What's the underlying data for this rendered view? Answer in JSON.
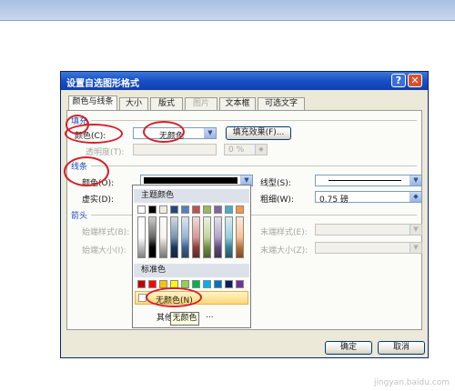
{
  "dialog": {
    "title": "设置自选图形格式",
    "help_glyph": "?",
    "close_glyph": "✕",
    "tabs": [
      {
        "label": "颜色与线条",
        "state": "active"
      },
      {
        "label": "大小",
        "state": "normal"
      },
      {
        "label": "版式",
        "state": "normal"
      },
      {
        "label": "图片",
        "state": "disabled"
      },
      {
        "label": "文本框",
        "state": "normal"
      },
      {
        "label": "可选文字",
        "state": "normal"
      }
    ],
    "fill": {
      "section": "填充",
      "color_label": "颜色(C):",
      "color_value": "无颜色",
      "effects_button": "填充效果(F)...",
      "transparency_label": "透明度(T):",
      "transparency_value": "0 %"
    },
    "line": {
      "section": "线条",
      "color_label": "颜色(O):",
      "dashed_label": "虚实(D):",
      "style_label": "线型(S):",
      "weight_label": "粗细(W):",
      "weight_value": "0.75 磅"
    },
    "arrows": {
      "section": "箭头",
      "begin_style": "始端样式(B):",
      "begin_size": "始端大小(I):",
      "end_style": "末端样式(E):",
      "end_size": "末端大小(Z):"
    },
    "buttons": {
      "ok": "确定",
      "cancel": "取消"
    }
  },
  "color_popup": {
    "theme_header": "主题颜色",
    "standard_header": "标准色",
    "no_color": "无颜色(N)",
    "more_colors": "其他",
    "more_colors_suffix": "...",
    "tooltip": "无颜色",
    "theme_colors": [
      "#ffffff",
      "#000000",
      "#eeece1",
      "#1f497d",
      "#4f81bd",
      "#c0504d",
      "#9bbb59",
      "#8064a2",
      "#4bacc6",
      "#f79646"
    ],
    "standard_colors": [
      "#c00000",
      "#ff0000",
      "#ffc000",
      "#ffff00",
      "#92d050",
      "#00b050",
      "#00b0f0",
      "#0070c0",
      "#002060",
      "#7030a0"
    ]
  },
  "annotation_color": "#d4202a",
  "watermark": "jingyan.baidu.com"
}
